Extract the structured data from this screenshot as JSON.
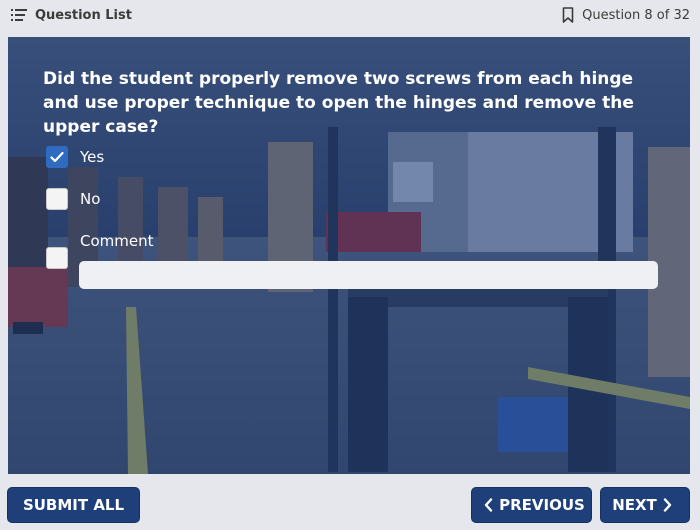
{
  "header": {
    "question_list_label": "Question List",
    "question_counter": "Question 8 of 32",
    "list_icon": "list-icon",
    "bookmark_icon": "bookmark-icon"
  },
  "question": {
    "text": "Did the student properly remove two screws from each hinge and use proper technique to open the hinges and remove the upper case?",
    "options": [
      {
        "label": "Yes",
        "checked": true
      },
      {
        "label": "No",
        "checked": false
      }
    ],
    "comment": {
      "label": "Comment",
      "checked": false,
      "value": "",
      "placeholder": ""
    }
  },
  "footer": {
    "submit_label": "SUBMIT ALL",
    "previous_label": "PREVIOUS",
    "next_label": "NEXT"
  },
  "colors": {
    "accent": "#1f3f7a",
    "checkbox_checked": "#2f6cc1",
    "overlay": "#1a3876"
  }
}
